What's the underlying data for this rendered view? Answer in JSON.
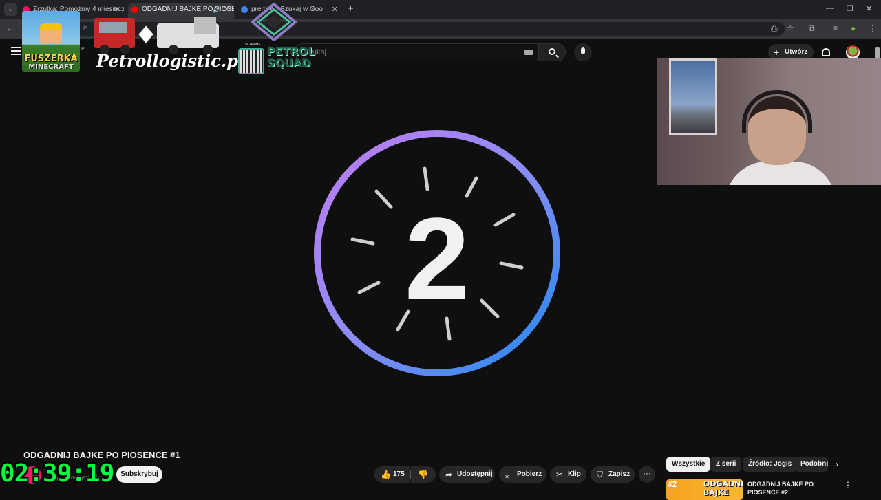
{
  "browser": {
    "tabs": [
      {
        "title": "Zrzutka: Pomóżmy 4 miesięcz",
        "favicon_color": "#e8175d"
      },
      {
        "title": "ODGADNIJ BAJKE PO PIOSE",
        "favicon_color": "#ff0000"
      },
      {
        "title": "premi    e - Szukaj w Goo",
        "favicon_color": "#4285f4"
      }
    ],
    "url_partial": "utub",
    "new_tab": "+",
    "close_glyph": "✕",
    "audio_glyph": "🔊"
  },
  "youtube": {
    "search": {
      "placeholder": "Szukaj"
    },
    "logo_partial": "PL",
    "create_label": "Utwórz",
    "video": {
      "countdown_number": "2",
      "title": "ODGADNIJ BAJKE PO PIOSENCE #1",
      "subscribers_partial": "tys. subskrybentów",
      "subscribe_label": "Subskrybuj",
      "likes": "175",
      "share_label": "Udostępnij",
      "download_label": "Pobierz",
      "clip_label": "Klip",
      "save_label": "Zapisz"
    },
    "sidebar": {
      "chips": [
        "Wszystkie",
        "Z serii",
        "Źródło: Jogis",
        "Podobne"
      ],
      "recommended": {
        "title": "ODGADNIJ BAJKE PO PIOSENCE #2",
        "thumb_number": "#2",
        "thumb_text": "ODGADNIJ BAJKE"
      }
    }
  },
  "stream_overlay": {
    "timer": "02:39:19",
    "fuszerka_title": "FUSZERKA",
    "fuszerka_subtitle": "MINECRAFT",
    "sponsor_text": "Petrollogistic.pl",
    "squad_line1": "PETROL",
    "squad_line2": "SQUAD",
    "scan_me": "SCAN ME"
  },
  "colors": {
    "countdown_gradient_start": "#b57cf0",
    "countdown_gradient_end": "#1e88f0",
    "timer_color": "#00ff3c",
    "yt_background": "#0f0f0f"
  },
  "icons": [
    "menu-icon",
    "search-icon",
    "microphone-icon",
    "bell-icon",
    "like-icon",
    "dislike-icon",
    "share-icon",
    "download-icon",
    "scissors-icon",
    "bookmark-icon",
    "more-icon"
  ]
}
